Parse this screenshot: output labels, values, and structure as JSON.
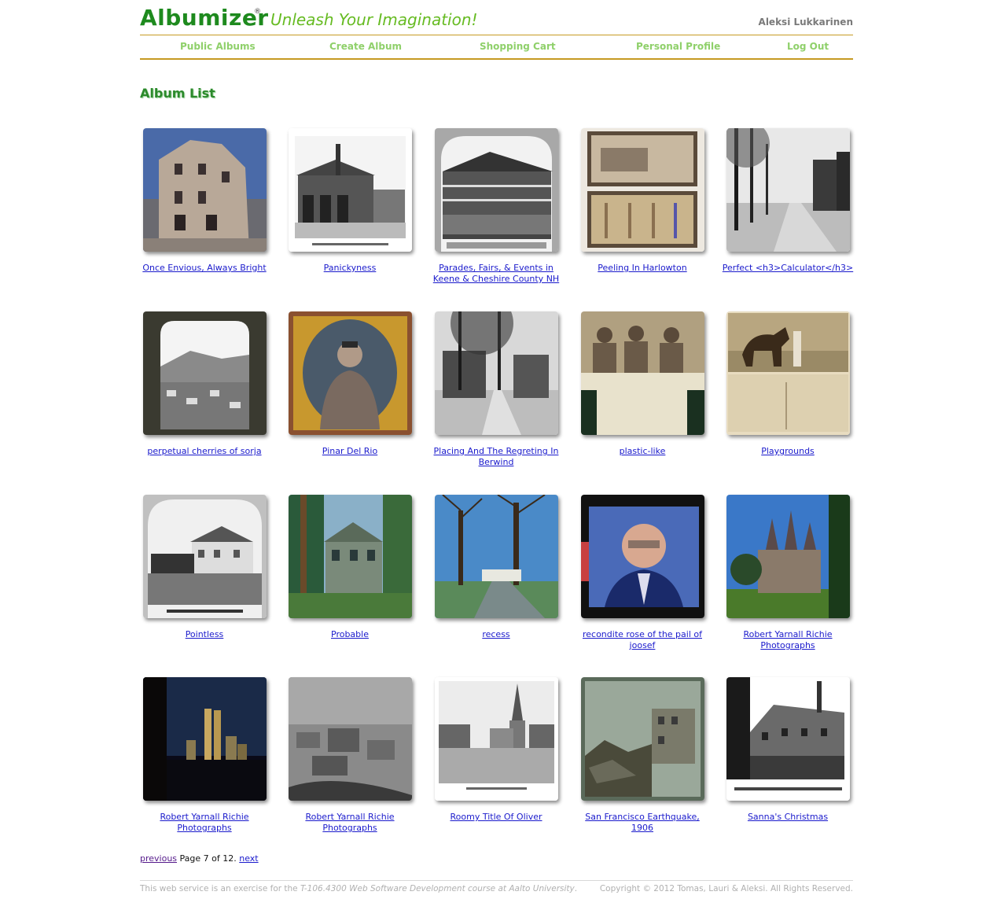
{
  "header": {
    "logo": "Albumizer",
    "logo_mark": "®",
    "tagline": "Unleash Your Imagination!",
    "username": "Aleksi Lukkarinen"
  },
  "nav": {
    "items": [
      {
        "label": "Public Albums"
      },
      {
        "label": "Create Album"
      },
      {
        "label": "Shopping Cart"
      },
      {
        "label": "Personal Profile"
      },
      {
        "label": "Log Out"
      }
    ]
  },
  "main": {
    "title": "Album List",
    "albums": [
      {
        "title": "Once Envious, Always Bright"
      },
      {
        "title": "Panickyness"
      },
      {
        "title": "Parades, Fairs, & Events in Keene & Cheshire County NH"
      },
      {
        "title": "Peeling In Harlowton"
      },
      {
        "title": "Perfect <h3>Calculator</h3>"
      },
      {
        "title": "perpetual cherries of sorja"
      },
      {
        "title": "Pinar Del Rio"
      },
      {
        "title": "Placing And The Regreting In Berwind"
      },
      {
        "title": "plastic-like"
      },
      {
        "title": "Playgrounds"
      },
      {
        "title": "Pointless"
      },
      {
        "title": "Probable"
      },
      {
        "title": "recess"
      },
      {
        "title": "recondite rose of the pail of joosef"
      },
      {
        "title": "Robert Yarnall Richie Photographs"
      },
      {
        "title": "Robert Yarnall Richie Photographs"
      },
      {
        "title": "Robert Yarnall Richie Photographs"
      },
      {
        "title": "Roomy Title Of Oliver"
      },
      {
        "title": "San Francisco Earthquake, 1906"
      },
      {
        "title": "Sanna's Christmas"
      }
    ]
  },
  "pagination": {
    "previous": "previous",
    "text": "Page 7 of 12.",
    "next": "next"
  },
  "footer": {
    "left_prefix": "This web service is an exercise for the",
    "course": "T-106.4300 Web Software Development course at",
    "university": "Aalto University",
    "left_suffix": ".",
    "right": "Copyright © 2012 Tomas, Lauri & Aleksi. All Rights Reserved."
  }
}
